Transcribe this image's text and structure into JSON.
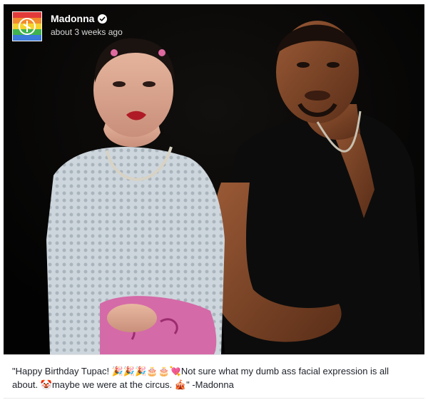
{
  "post": {
    "author_name": "Madonna",
    "timestamp": "about 3 weeks ago",
    "verified_icon": "verified-badge-icon",
    "avatar_icon": "rainbow-logo-avatar",
    "photo_icon": "photo-madonna-and-tupac",
    "caption": "\"Happy Birthday Tupac! 🎉🎉🎉🎂🎂💘Not sure what my dumb ass facial expression is all about. 🤡maybe we were at the circus. 🎪\" -Madonna"
  },
  "colors": {
    "media_background": "#000000",
    "author_text": "#ffffff",
    "timestamp_text": "#d9d9d9",
    "caption_text": "#1d2129"
  }
}
